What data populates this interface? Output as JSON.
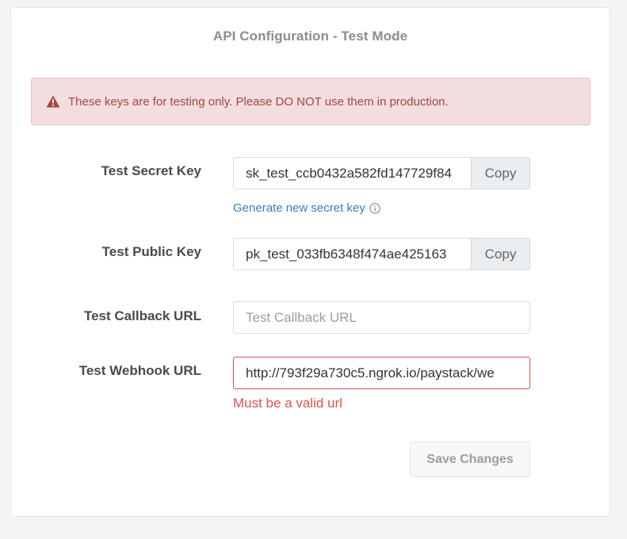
{
  "page": {
    "title": "API Configuration - Test Mode"
  },
  "alert": {
    "icon": "warning-icon",
    "color": "#a94442",
    "background": "#f2dede",
    "message": "These keys are for testing only. Please DO NOT use them in production."
  },
  "secret_key": {
    "label": "Test Secret Key",
    "value": "sk_test_ccb0432a582fd147729f84",
    "copy_label": "Copy",
    "generate_link": "Generate new secret key",
    "info_icon": "info-icon"
  },
  "public_key": {
    "label": "Test Public Key",
    "value": "pk_test_033fb6348f474ae425163",
    "copy_label": "Copy"
  },
  "callback_url": {
    "label": "Test Callback URL",
    "value": "",
    "placeholder": "Test Callback URL"
  },
  "webhook_url": {
    "label": "Test Webhook URL",
    "value": "http://793f29a730c5.ngrok.io/paystack/we",
    "error": "Must be a valid url",
    "error_color": "#d9534f"
  },
  "actions": {
    "save_label": "Save Changes"
  },
  "colors": {
    "link": "#3a7bc8",
    "accent_border": "#d9534f"
  }
}
